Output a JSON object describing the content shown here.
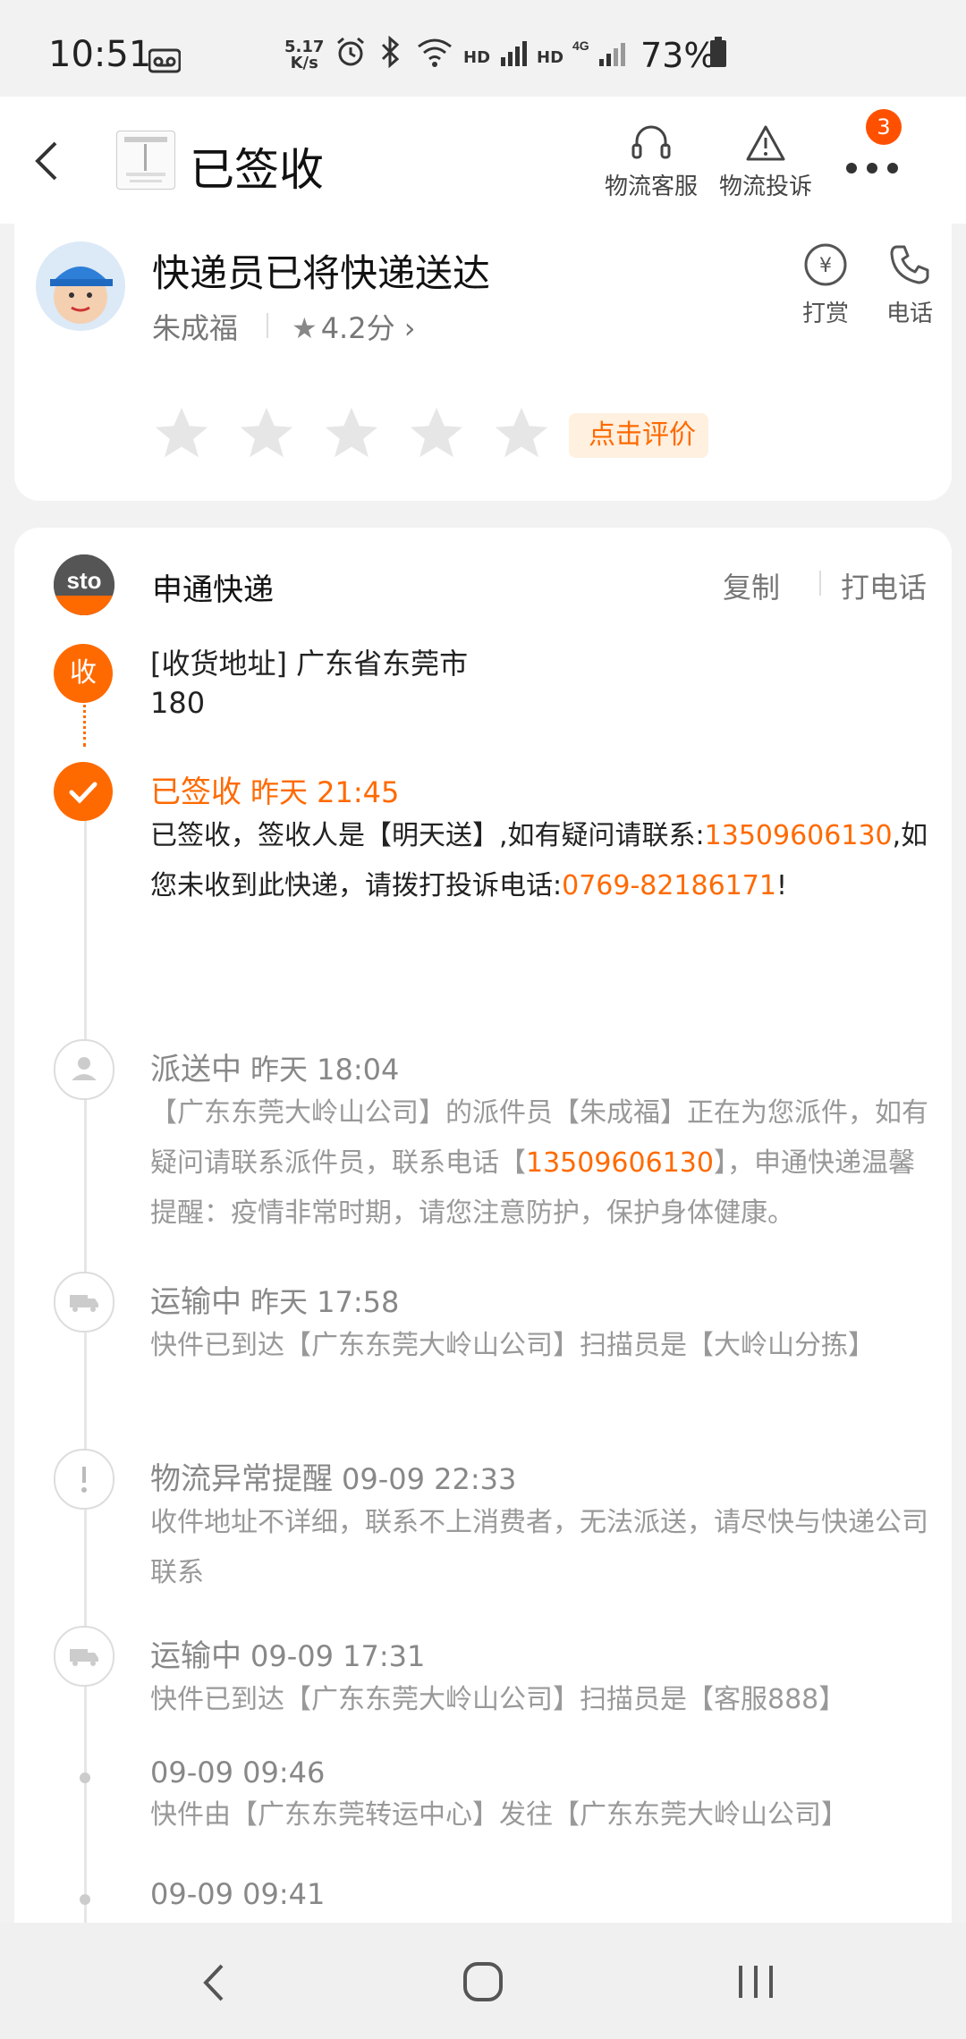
{
  "status_bar": {
    "time": "10:51",
    "net_speed_value": "5.17",
    "net_speed_unit": "K/s",
    "hd1": "HD",
    "hd2": "HD",
    "battery": "73%"
  },
  "header": {
    "title": "已签收",
    "actions": [
      {
        "label": "物流客服",
        "icon": "headset-icon"
      },
      {
        "label": "物流投诉",
        "icon": "warning-icon"
      }
    ],
    "more_badge": "3"
  },
  "courier": {
    "headline": "快递员已将快递送达",
    "name": "朱成福",
    "rating": "4.2分",
    "actions": [
      {
        "label": "打赏",
        "icon": "yen-icon"
      },
      {
        "label": "电话",
        "icon": "phone-icon"
      }
    ],
    "rate_cta": "点击评价"
  },
  "carrier": {
    "name": "申通快递",
    "copy_label": "复制",
    "call_label": "打电话"
  },
  "address": {
    "node_label": "收",
    "line1": "[收货地址] 广东省东莞市",
    "line2": "180"
  },
  "events": [
    {
      "status": "已签收",
      "time": "昨天 21:45",
      "active": true,
      "text_a": "已签收，签收人是【明天送】,如有疑问请联系:",
      "phone": "13509606130",
      "text_b": ",如您未收到此快递，请拨打投诉电话:",
      "phone2": "0769-82186171",
      "text_c": "!"
    },
    {
      "status": "派送中",
      "time": "昨天 18:04",
      "text_a": "【广东东莞大岭山公司】的派件员【朱成福】正在为您派件，如有疑问请联系派件员，联系电话【",
      "phone": "13509606130",
      "text_b": "】，申通快递温馨提醒：疫情非常时期，请您注意防护，保护身体健康。"
    },
    {
      "status": "运输中",
      "time": "昨天 17:58",
      "text": "快件已到达【广东东莞大岭山公司】扫描员是【大岭山分拣】"
    },
    {
      "status": "物流异常提醒",
      "time": "09-09 22:33",
      "text": "收件地址不详细，联系不上消费者，无法派送，请尽快与快递公司联系"
    },
    {
      "status": "运输中",
      "time": "09-09 17:31",
      "text": "快件已到达【广东东莞大岭山公司】扫描员是【客服888】"
    },
    {
      "time": "09-09 09:46",
      "text": "快件由【广东东莞转运中心】发往【广东东莞大岭山公司】"
    },
    {
      "time": "09-09 09:41"
    }
  ],
  "colors": {
    "accent": "#ff6a00",
    "badge": "#ff5000",
    "muted": "#999999"
  }
}
